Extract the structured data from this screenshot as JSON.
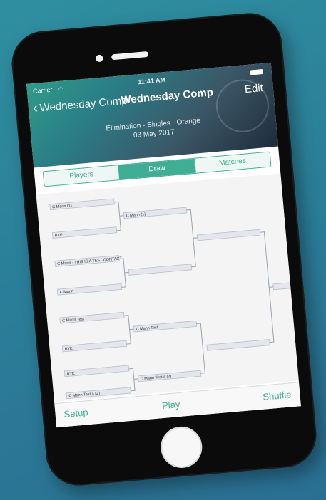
{
  "status_bar": {
    "carrier": "Carrier",
    "time": "11:41 AM"
  },
  "nav": {
    "back_label": "Wednesday Comp",
    "title": "Wednesday Comp",
    "edit_label": "Edit"
  },
  "competition": {
    "format": "Elimination - Singles - Orange",
    "date": "03 May 2017"
  },
  "tabs": [
    {
      "label": "Players",
      "active": false
    },
    {
      "label": "Draw",
      "active": true
    },
    {
      "label": "Matches",
      "active": false
    }
  ],
  "bracket": {
    "round1": [
      "C Mann (1)",
      "BYE",
      "C Mann - THIS IS A TEST CONTACT",
      "C Mann",
      "C Mann Test",
      "BYE",
      "BYE",
      "C Mann Test a (2)"
    ],
    "round2": [
      "C Mann (1)",
      "",
      "C Mann Test",
      "C Mann Test a (2)"
    ],
    "round3": [
      "",
      ""
    ],
    "final": [
      ""
    ]
  },
  "toolbar": {
    "setup_label": "Setup",
    "play_label": "Play",
    "shuffle_label": "Shuffle"
  },
  "colors": {
    "accent": "#3fae94",
    "background": "#2b7f99"
  }
}
